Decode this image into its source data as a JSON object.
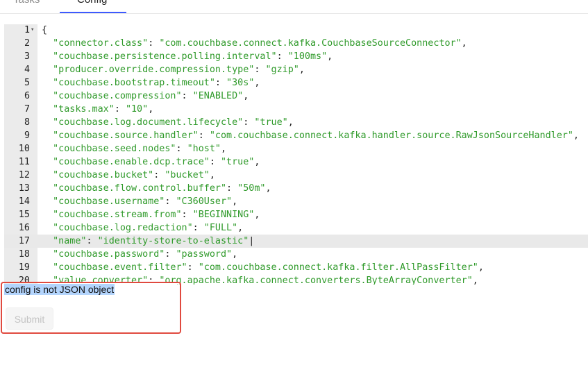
{
  "tabs": [
    {
      "label": "Tasks"
    },
    {
      "label": "Config"
    }
  ],
  "editor": {
    "lines": [
      {
        "num": "1",
        "parts": [
          {
            "t": "p",
            "v": "{"
          }
        ]
      },
      {
        "num": "2",
        "parts": [
          {
            "t": "k",
            "v": "  \"connector.class\""
          },
          {
            "t": "p",
            "v": ": "
          },
          {
            "t": "s",
            "v": "\"com.couchbase.connect.kafka.CouchbaseSourceConnector\""
          },
          {
            "t": "p",
            "v": ","
          }
        ]
      },
      {
        "num": "3",
        "parts": [
          {
            "t": "k",
            "v": "  \"couchbase.persistence.polling.interval\""
          },
          {
            "t": "p",
            "v": ": "
          },
          {
            "t": "s",
            "v": "\"100ms\""
          },
          {
            "t": "p",
            "v": ","
          }
        ]
      },
      {
        "num": "4",
        "parts": [
          {
            "t": "k",
            "v": "  \"producer.override.compression.type\""
          },
          {
            "t": "p",
            "v": ": "
          },
          {
            "t": "s",
            "v": "\"gzip\""
          },
          {
            "t": "p",
            "v": ","
          }
        ]
      },
      {
        "num": "5",
        "parts": [
          {
            "t": "k",
            "v": "  \"couchbase.bootstrap.timeout\""
          },
          {
            "t": "p",
            "v": ": "
          },
          {
            "t": "s",
            "v": "\"30s\""
          },
          {
            "t": "p",
            "v": ","
          }
        ]
      },
      {
        "num": "6",
        "parts": [
          {
            "t": "k",
            "v": "  \"couchbase.compression\""
          },
          {
            "t": "p",
            "v": ": "
          },
          {
            "t": "s",
            "v": "\"ENABLED\""
          },
          {
            "t": "p",
            "v": ","
          }
        ]
      },
      {
        "num": "7",
        "parts": [
          {
            "t": "k",
            "v": "  \"tasks.max\""
          },
          {
            "t": "p",
            "v": ": "
          },
          {
            "t": "s",
            "v": "\"10\""
          },
          {
            "t": "p",
            "v": ","
          }
        ]
      },
      {
        "num": "8",
        "parts": [
          {
            "t": "k",
            "v": "  \"couchbase.log.document.lifecycle\""
          },
          {
            "t": "p",
            "v": ": "
          },
          {
            "t": "s",
            "v": "\"true\""
          },
          {
            "t": "p",
            "v": ","
          }
        ]
      },
      {
        "num": "9",
        "parts": [
          {
            "t": "k",
            "v": "  \"couchbase.source.handler\""
          },
          {
            "t": "p",
            "v": ": "
          },
          {
            "t": "s",
            "v": "\"com.couchbase.connect.kafka.handler.source.RawJsonSourceHandler\""
          },
          {
            "t": "p",
            "v": ","
          }
        ]
      },
      {
        "num": "10",
        "parts": [
          {
            "t": "k",
            "v": "  \"couchbase.seed.nodes\""
          },
          {
            "t": "p",
            "v": ": "
          },
          {
            "t": "s",
            "v": "\"host\""
          },
          {
            "t": "p",
            "v": ","
          }
        ]
      },
      {
        "num": "11",
        "parts": [
          {
            "t": "k",
            "v": "  \"couchbase.enable.dcp.trace\""
          },
          {
            "t": "p",
            "v": ": "
          },
          {
            "t": "s",
            "v": "\"true\""
          },
          {
            "t": "p",
            "v": ","
          }
        ]
      },
      {
        "num": "12",
        "parts": [
          {
            "t": "k",
            "v": "  \"couchbase.bucket\""
          },
          {
            "t": "p",
            "v": ": "
          },
          {
            "t": "s",
            "v": "\"bucket\""
          },
          {
            "t": "p",
            "v": ","
          }
        ]
      },
      {
        "num": "13",
        "parts": [
          {
            "t": "k",
            "v": "  \"couchbase.flow.control.buffer\""
          },
          {
            "t": "p",
            "v": ": "
          },
          {
            "t": "s",
            "v": "\"50m\""
          },
          {
            "t": "p",
            "v": ","
          }
        ]
      },
      {
        "num": "14",
        "parts": [
          {
            "t": "k",
            "v": "  \"couchbase.username\""
          },
          {
            "t": "p",
            "v": ": "
          },
          {
            "t": "s",
            "v": "\"C360User\""
          },
          {
            "t": "p",
            "v": ","
          }
        ]
      },
      {
        "num": "15",
        "parts": [
          {
            "t": "k",
            "v": "  \"couchbase.stream.from\""
          },
          {
            "t": "p",
            "v": ": "
          },
          {
            "t": "s",
            "v": "\"BEGINNING\""
          },
          {
            "t": "p",
            "v": ","
          }
        ]
      },
      {
        "num": "16",
        "parts": [
          {
            "t": "k",
            "v": "  \"couchbase.log.redaction\""
          },
          {
            "t": "p",
            "v": ": "
          },
          {
            "t": "s",
            "v": "\"FULL\""
          },
          {
            "t": "p",
            "v": ","
          }
        ]
      },
      {
        "num": "17",
        "active": true,
        "parts": [
          {
            "t": "k",
            "v": "  \"name\""
          },
          {
            "t": "p",
            "v": ": "
          },
          {
            "t": "s",
            "v": "\"identity-store-to-elastic\""
          },
          {
            "t": "p",
            "v": "|"
          }
        ]
      },
      {
        "num": "18",
        "parts": [
          {
            "t": "k",
            "v": "  \"couchbase.password\""
          },
          {
            "t": "p",
            "v": ": "
          },
          {
            "t": "s",
            "v": "\"password\""
          },
          {
            "t": "p",
            "v": ","
          }
        ]
      },
      {
        "num": "19",
        "parts": [
          {
            "t": "k",
            "v": "  \"couchbase.event.filter\""
          },
          {
            "t": "p",
            "v": ": "
          },
          {
            "t": "s",
            "v": "\"com.couchbase.connect.kafka.filter.AllPassFilter\""
          },
          {
            "t": "p",
            "v": ","
          }
        ]
      },
      {
        "num": "20",
        "parts": [
          {
            "t": "k",
            "v": "  \"value.converter\""
          },
          {
            "t": "p",
            "v": ": "
          },
          {
            "t": "s",
            "v": "\"org.apache.kafka.connect.converters.ByteArrayConverter\""
          },
          {
            "t": "p",
            "v": ","
          }
        ]
      }
    ]
  },
  "error": {
    "message": "config is not JSON object"
  },
  "submit": {
    "label": "Submit"
  },
  "colors": {
    "key": "#2f9a2a",
    "error_border": "#e04a3f",
    "selection": "#b3d4fc",
    "tab_accent": "#3d5afe"
  }
}
